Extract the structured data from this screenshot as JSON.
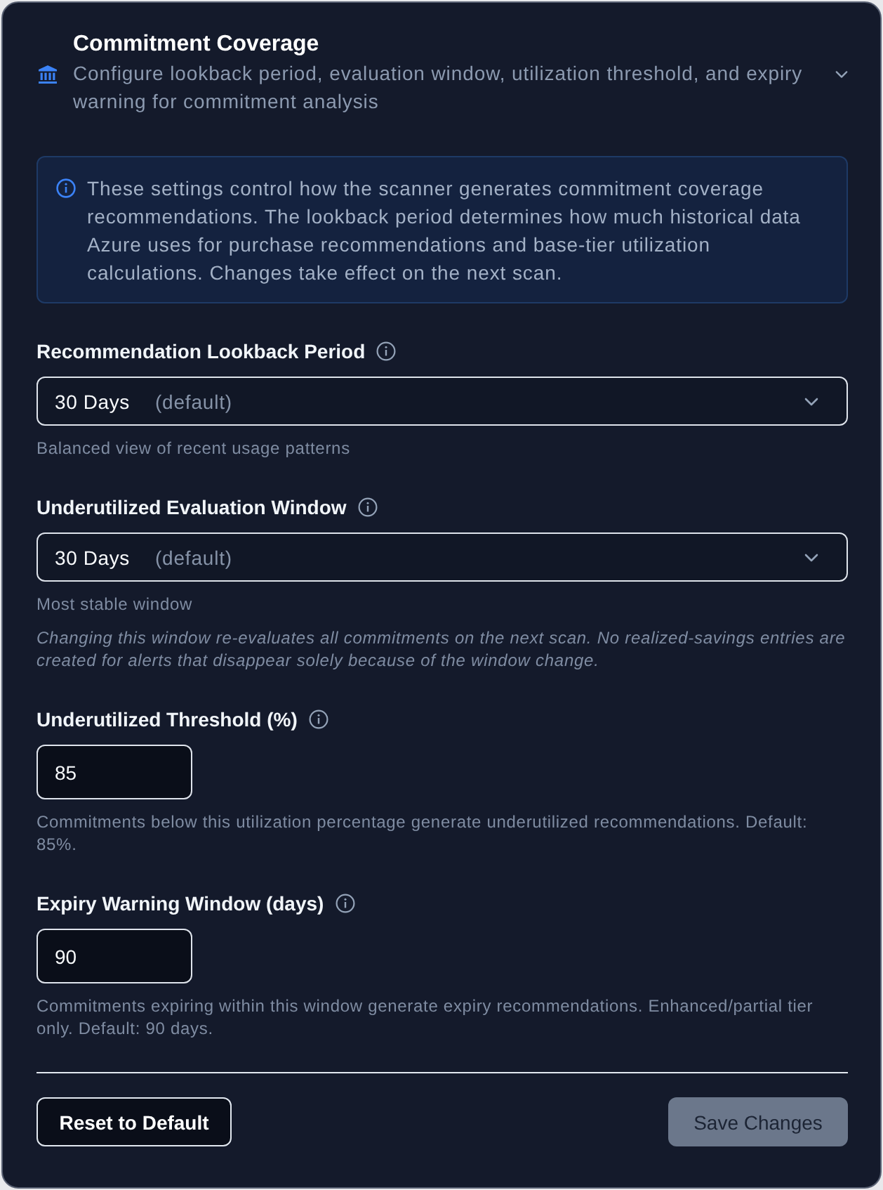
{
  "section": {
    "title": "Commitment Coverage",
    "subtitle": "Configure lookback period, evaluation window, utilization threshold, and expiry warning for commitment analysis",
    "expanded": true
  },
  "info_box": {
    "text": "These settings control how the scanner generates commitment coverage recommendations. The lookback period determines how much historical data Azure uses for purchase recommendations and base-tier utilization calculations. Changes take effect on the next scan."
  },
  "fields": [
    {
      "kind": "select",
      "label": "Recommendation Lookback Period",
      "value": "30 Days",
      "value_note": "(default)",
      "help": "Balanced view of recent usage patterns"
    },
    {
      "kind": "select",
      "label": "Underutilized Evaluation Window",
      "value": "30 Days",
      "value_note": "(default)",
      "help": "Most stable window",
      "note": "Changing this window re-evaluates all commitments on the next scan. No realized-savings entries are created for alerts that disappear solely because of the window change."
    },
    {
      "kind": "number",
      "label": "Underutilized Threshold (%)",
      "value": "85",
      "help": "Commitments below this utilization percentage generate underutilized recommendations. Default: 85%."
    },
    {
      "kind": "number",
      "label": "Expiry Warning Window (days)",
      "value": "90",
      "help": "Commitments expiring within this window generate expiry recommendations. Enhanced/partial tier only. Default: 90 days."
    }
  ],
  "buttons": [
    {
      "label": "Reset to Default",
      "kind": "secondary",
      "disabled": false
    },
    {
      "label": "Save Changes",
      "kind": "primary",
      "disabled": true
    }
  ]
}
